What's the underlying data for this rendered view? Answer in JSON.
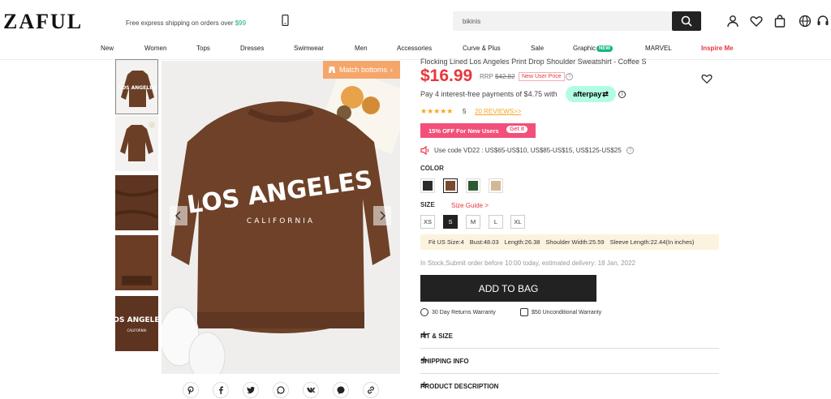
{
  "header": {
    "logo": "ZAFUL",
    "promo_text": "Free express shipping on orders over ",
    "promo_amount": "$99",
    "search_value": "bikinis"
  },
  "nav": {
    "items": [
      "New",
      "Women",
      "Tops",
      "Dresses",
      "Swimwear",
      "Men",
      "Accessories",
      "Curve & Plus",
      "Sale",
      "Graphic",
      "MARVEL",
      "Inspire Me"
    ],
    "new_badge": "NEW"
  },
  "gallery": {
    "match_label": "Match bottoms",
    "thumb_text": "LOS ANGELES",
    "thumb_small": "CALIFORNIA"
  },
  "product": {
    "title": "Flocking Lined Los Angeles Print Drop Shoulder Sweatshirt - Coffee S",
    "price": "$16.99",
    "rrp_label": "RRP",
    "rrp_value": "$42.82",
    "new_user_price": "New User Price",
    "installment_text": "Pay 4 interest-free payments of $4.75 with",
    "afterpay": "afterpay",
    "stars": "★★★★★",
    "rating": "5",
    "reviews": "20 REVIEWS>>",
    "coupon_text": "15% OFF For New Users",
    "coupon_btn": "Get it",
    "code_text": "Use code VD22 : US$65-US$10, US$85-US$15, US$125-US$25",
    "color_label": "COLOR",
    "colors": [
      "#2b2b2b",
      "#7a4a2e",
      "#2d5a32",
      "#d4b896"
    ],
    "size_label": "SIZE",
    "size_guide": "Size Guide >",
    "sizes": [
      "XS",
      "S",
      "M",
      "L",
      "XL"
    ],
    "fit": [
      "Fit US Size:4",
      "Bust:48.03",
      "Length:26.38",
      "Shoulder Width:25.59",
      "Sleeve Length:22.44(In inches)"
    ],
    "stock_text": "In Stock,Submit order before 10:00 today, estimated delivery: 18 Jan, 2022",
    "add_to_bag": "ADD TO BAG",
    "returns": "30 Day Returns Warranty",
    "guarantee": "$50 Unconditional Warranty",
    "accordions": [
      "FIT & SIZE",
      "SHIPPING INFO",
      "PRODUCT DESCRIPTION"
    ],
    "plus": "+"
  },
  "image_print": {
    "line1": "LOS ANGELES",
    "line2": "CALIFORNIA"
  }
}
